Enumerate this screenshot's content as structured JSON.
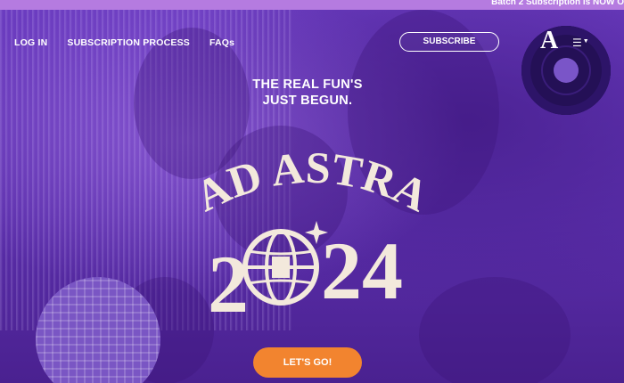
{
  "ticker": {
    "text": "Batch 2 Subscription is NOW O"
  },
  "nav": {
    "items": [
      {
        "label": "LOG IN"
      },
      {
        "label": "SUBSCRIPTION PROCESS"
      },
      {
        "label": "FAQs"
      }
    ],
    "subscribe_label": "SUBSCRIBE",
    "logo_text": "A",
    "menu_icon": "hamburger-menu-icon"
  },
  "hero": {
    "tagline_line1": "THE REAL FUN'S",
    "tagline_line2": "JUST BEGUN.",
    "title_line1": "AD ASTRA",
    "year_left": "2",
    "year_right": "24",
    "cta_label": "LET'S GO!"
  },
  "colors": {
    "ticker_bg": "#b57be0",
    "hero_tint": "#5b2fa8",
    "title_text": "#f3e9dc",
    "cta_bg": "#f2842f"
  }
}
